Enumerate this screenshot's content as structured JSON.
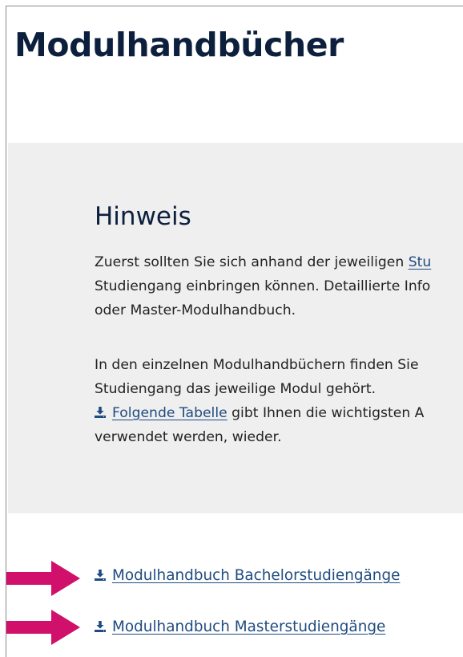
{
  "page": {
    "title": "Modulhandbücher"
  },
  "hint": {
    "title": "Hinweis",
    "p1_line1_text": "Zuerst sollten Sie sich anhand der jeweiligen ",
    "p1_line1_link": "Stu",
    "p1_line2": "Studiengang einbringen können. Detaillierte Info",
    "p1_line3": "oder Master-Modulhandbuch.",
    "p2_line1": "In den einzelnen Modulhandbüchern finden Sie",
    "p2_line2": "Studiengang das jeweilige Modul gehört.",
    "p2_line3_link": "Folgende Tabelle",
    "p2_line3_text": " gibt Ihnen die wichtigsten A",
    "p2_line4": "verwendet werden, wieder."
  },
  "downloads": [
    {
      "label": "Modulhandbuch Bachelorstudiengänge",
      "icon": "download-icon"
    },
    {
      "label": "Modulhandbuch Masterstudiengänge",
      "icon": "download-icon"
    }
  ],
  "colors": {
    "title": "#0c1f3d",
    "link": "#1f4b80",
    "hint_background": "#efefef",
    "arrow": "#d0106a"
  }
}
